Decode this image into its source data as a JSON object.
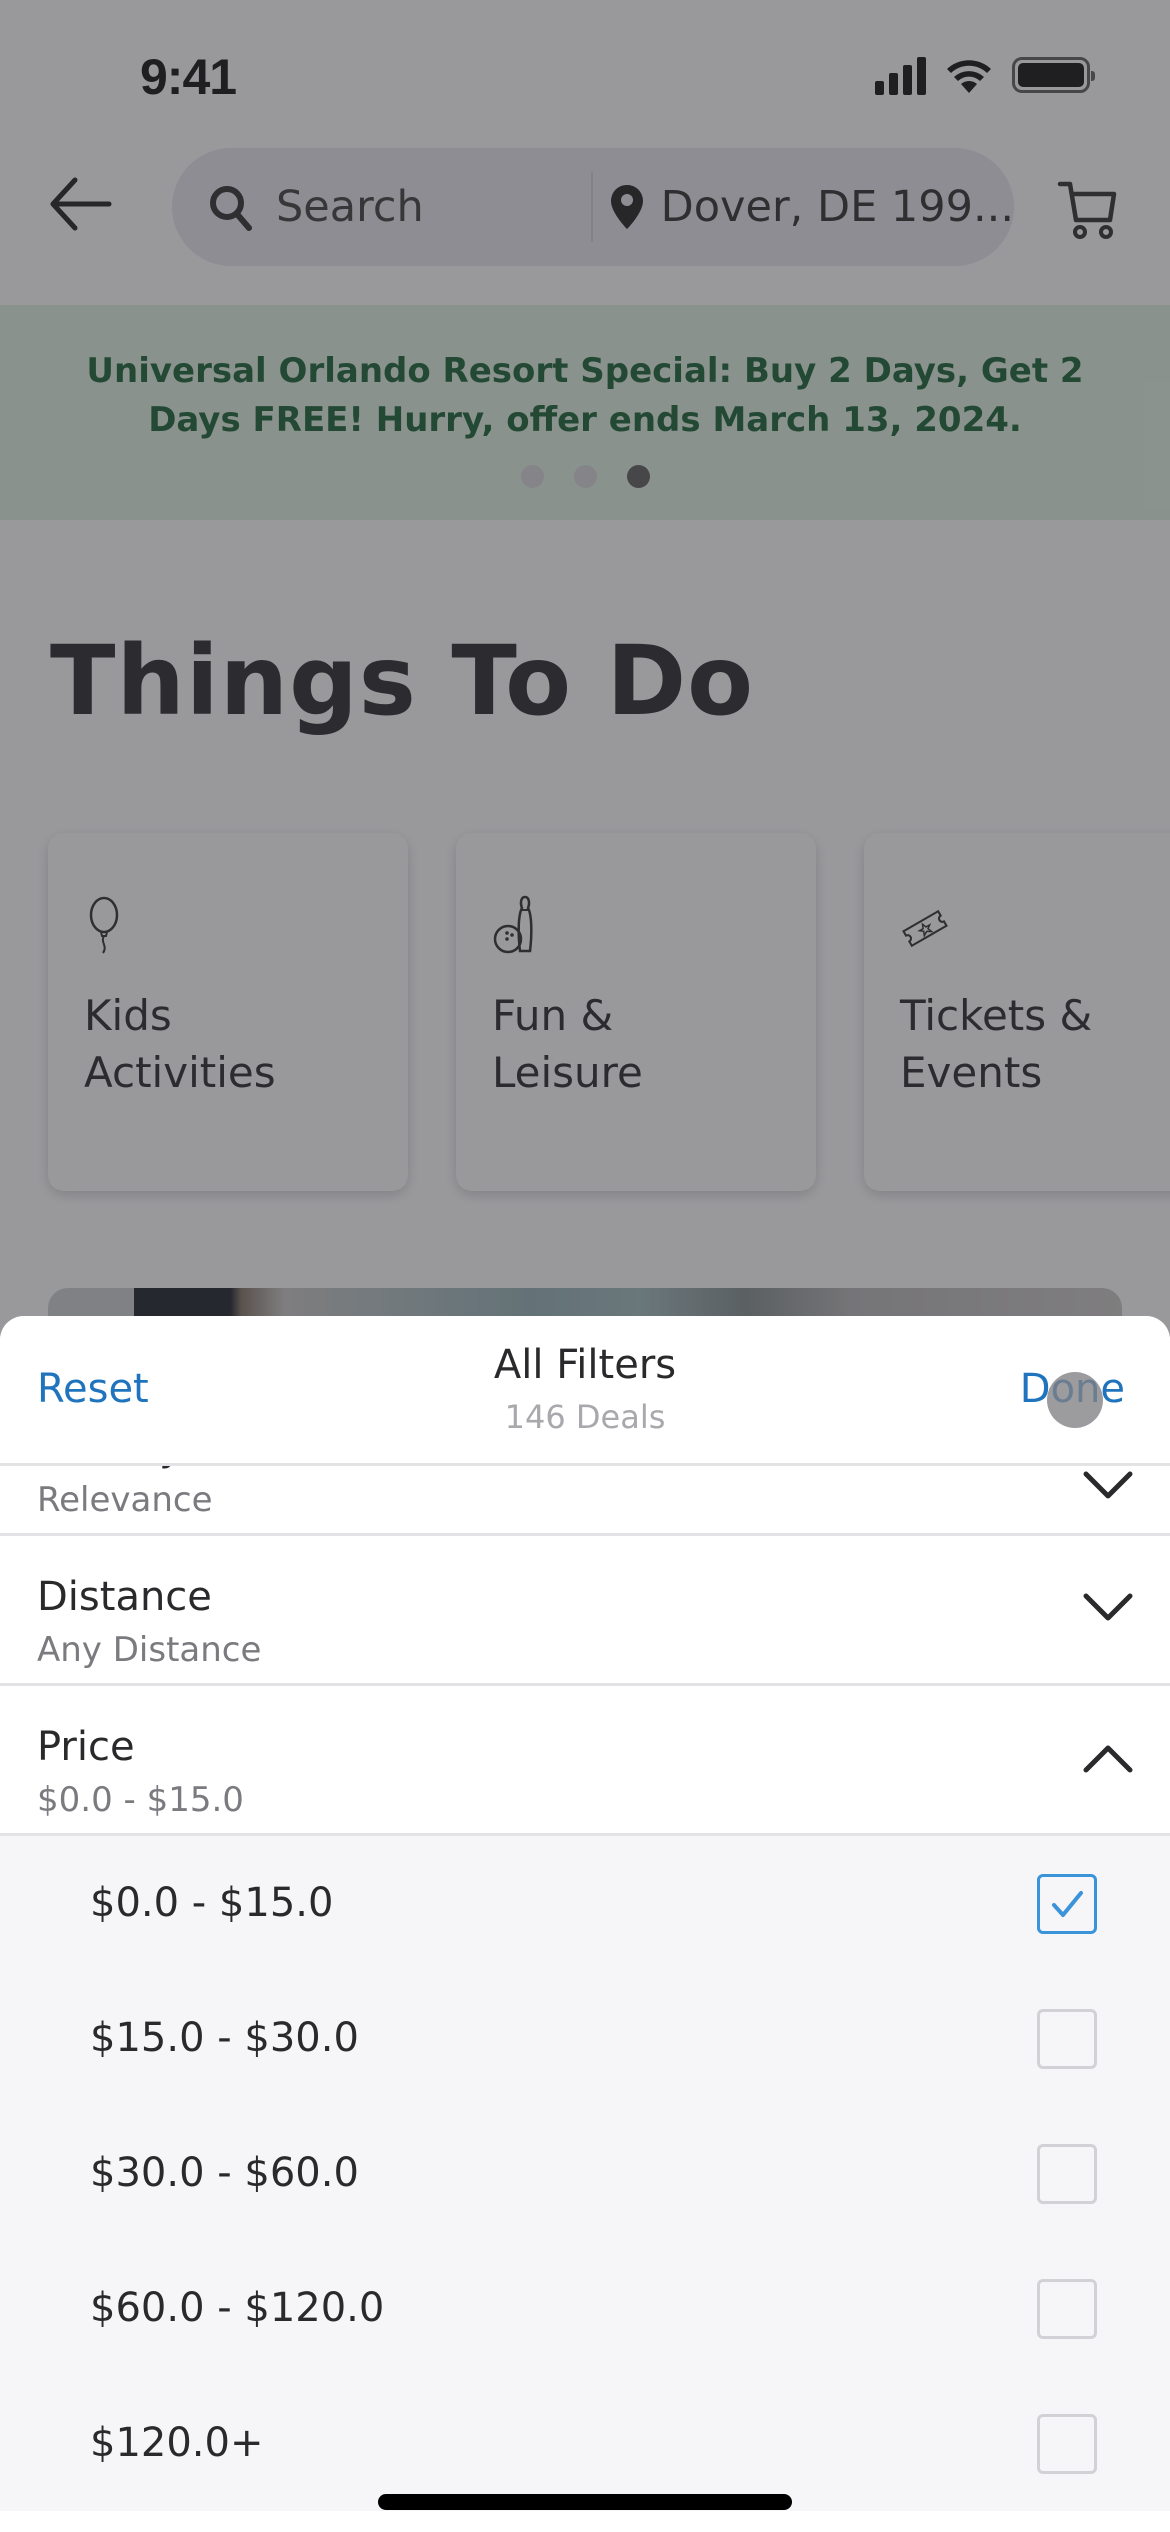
{
  "status_bar": {
    "time": "9:41",
    "icons": [
      "cellular-signal-icon",
      "wifi-icon",
      "battery-icon"
    ]
  },
  "nav": {
    "back_icon": "arrow-left-icon",
    "search_placeholder": "Search",
    "search_icon": "magnifier-icon",
    "location": "Dover, DE 199...",
    "location_icon": "map-pin-icon",
    "cart_icon": "shopping-cart-icon"
  },
  "promo": {
    "text": "Universal Orlando Resort Special: Buy 2 Days, Get 2 Days FREE! Hurry, offer ends March 13, 2024.",
    "page_count": 3,
    "active_page": 3,
    "text_color": "#0a5a2a",
    "background": "#dff3e2"
  },
  "section": {
    "title": "Things To Do"
  },
  "categories": [
    {
      "label": "Kids\nActivities",
      "icon": "balloon-icon"
    },
    {
      "label": "Fun &\nLeisure",
      "icon": "bowling-icon"
    },
    {
      "label": "Tickets &\nEvents",
      "icon": "ticket-icon"
    }
  ],
  "filters_sheet": {
    "reset_label": "Reset",
    "done_label": "Done",
    "title": "All Filters",
    "subtitle": "146 Deals",
    "accent_color": "#1f74bd",
    "groups": [
      {
        "label": "Sort By",
        "value": "Relevance",
        "expanded": false
      },
      {
        "label": "Distance",
        "value": "Any Distance",
        "expanded": false
      },
      {
        "label": "Price",
        "value": "$0.0 - $15.0",
        "expanded": true
      }
    ],
    "price_options": [
      {
        "label": "$0.0 - $15.0",
        "checked": true
      },
      {
        "label": "$15.0 - $30.0",
        "checked": false
      },
      {
        "label": "$30.0 - $60.0",
        "checked": false
      },
      {
        "label": "$60.0 - $120.0",
        "checked": false
      },
      {
        "label": "$120.0+",
        "checked": false
      }
    ],
    "checkbox_color": "#3b93da"
  }
}
